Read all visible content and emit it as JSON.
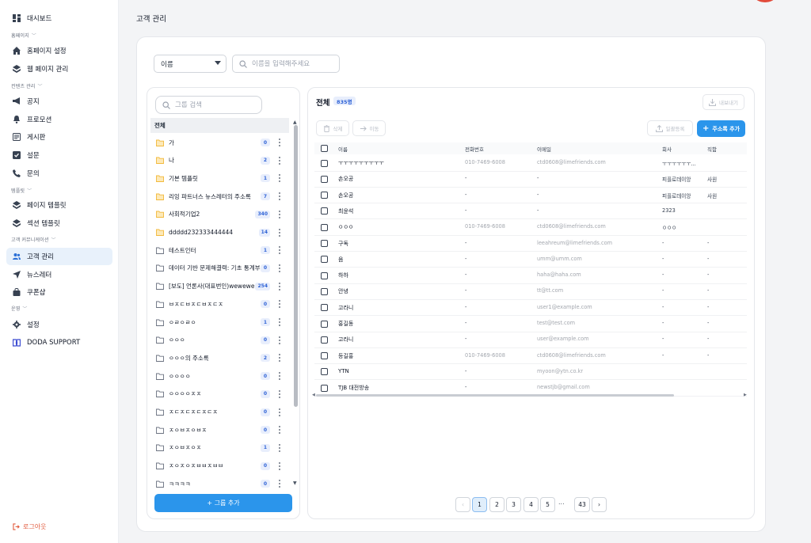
{
  "sidebar": {
    "items": [
      {
        "label": "대시보드",
        "icon": "dashboard-icon"
      },
      {
        "label": "홈페이지 설정",
        "icon": "home-icon"
      },
      {
        "label": "웹 페이지 관리",
        "icon": "layers-icon"
      },
      {
        "label": "공지",
        "icon": "megaphone-icon"
      },
      {
        "label": "프로모션",
        "icon": "bell-icon"
      },
      {
        "label": "게시판",
        "icon": "board-icon"
      },
      {
        "label": "설문",
        "icon": "checklist-icon"
      },
      {
        "label": "문의",
        "icon": "phone-icon"
      },
      {
        "label": "페이지 템플릿",
        "icon": "layers-icon"
      },
      {
        "label": "섹션 템플릿",
        "icon": "layers-icon"
      },
      {
        "label": "고객 관리",
        "icon": "users-icon"
      },
      {
        "label": "뉴스레터",
        "icon": "send-icon"
      },
      {
        "label": "쿠폰샵",
        "icon": "bag-icon"
      },
      {
        "label": "설정",
        "icon": "gear-icon"
      },
      {
        "label": "DODA SUPPORT",
        "icon": "doda-logo-icon"
      }
    ],
    "sections": [
      "홈페이지",
      "컨텐츠 관리",
      "템플릿",
      "고객 커뮤니케이션",
      "운영"
    ],
    "logout": "로그아웃",
    "active_index": 10
  },
  "page": {
    "title": "고객 관리"
  },
  "filter": {
    "selected": "이름",
    "search_placeholder": "이름을 입력해주세요"
  },
  "groups": {
    "search_placeholder": "그룹 검색",
    "all_label": "전체",
    "items": [
      {
        "name": "가",
        "count": "0"
      },
      {
        "name": "나",
        "count": "2"
      },
      {
        "name": "기본 템플릿",
        "count": "1"
      },
      {
        "name": "리잉 파트너스 뉴스레터의 주소록",
        "count": "7"
      },
      {
        "name": "사회적기업2",
        "count": "340"
      },
      {
        "name": "ddddd232333444444",
        "count": "14"
      },
      {
        "name": "테스트인터",
        "count": "1"
      },
      {
        "name": "데이터 기반 문제해결력: 기초 통계부",
        "count": "0"
      },
      {
        "name": "[보도] 언론사(대표번인)wewewe",
        "count": "254"
      },
      {
        "name": "ㅂㅈㄷㅂㅈㄷㅂㅈㄷㅈ",
        "count": "0"
      },
      {
        "name": "ㅇㄹㅇㄹㅇ",
        "count": "1"
      },
      {
        "name": "ㅇㅇㅇ",
        "count": "0"
      },
      {
        "name": "ㅇㅇㅇ의 주소록",
        "count": "2"
      },
      {
        "name": "ㅇㅇㅇㅇ",
        "count": "0"
      },
      {
        "name": "ㅇㅇㅇㅇㅈㅈ",
        "count": "0"
      },
      {
        "name": "ㅈㄷㅈㄷㅈㄷㅈㄷㅈ",
        "count": "0"
      },
      {
        "name": "ㅈㅇㅂㅈㅇㅂㅈ",
        "count": "0"
      },
      {
        "name": "ㅈㅇㅂㅈㅇㅈ",
        "count": "1"
      },
      {
        "name": "ㅈㅇㅈㅇㅈㅂㅂㅈㅂㅂ",
        "count": "0"
      },
      {
        "name": "ㅋㅋㅋㅋ",
        "count": "0"
      }
    ],
    "add_button": "+ 그룹 추가"
  },
  "contacts": {
    "title": "전체",
    "count_badge": "835명",
    "export_label": "내보내기",
    "delete_label": "삭제",
    "move_label": "이동",
    "bulk_label": "일괄등록",
    "add_label": "주소록 추가",
    "columns": [
      "이름",
      "전화번호",
      "이메일",
      "회사",
      "직함"
    ],
    "rows": [
      {
        "name": "ㅜㅜㅜㅜㅜㅜㅜㅜㅜ",
        "phone": "010-7469-6008",
        "email": "ctd0608@limefriends.com",
        "company": "ㅜㅜㅜㅜㅜㅜ...",
        "title": ""
      },
      {
        "name": "손오공",
        "phone": "-",
        "email": "-",
        "company": "피플로데이앙",
        "title": "사원"
      },
      {
        "name": "손오공",
        "phone": "-",
        "email": "-",
        "company": "피플로데이앙",
        "title": "사원"
      },
      {
        "name": "최윤석",
        "phone": "-",
        "email": "-",
        "company": "2323",
        "title": ""
      },
      {
        "name": "ㅇㅇㅇ",
        "phone": "010-7469-6008",
        "email": "ctd0608@limefriends.com",
        "company": "ㅇㅇㅇ",
        "title": ""
      },
      {
        "name": "구독",
        "phone": "-",
        "email": "leeahreum@limefriends.com",
        "company": "-",
        "title": "-"
      },
      {
        "name": "음",
        "phone": "-",
        "email": "umm@umm.com",
        "company": "-",
        "title": "-"
      },
      {
        "name": "하하",
        "phone": "-",
        "email": "haha@haha.com",
        "company": "-",
        "title": "-"
      },
      {
        "name": "안녕",
        "phone": "-",
        "email": "tt@tt.com",
        "company": "-",
        "title": "-"
      },
      {
        "name": "고라니",
        "phone": "-",
        "email": "user1@example.com",
        "company": "-",
        "title": "-"
      },
      {
        "name": "홍길동",
        "phone": "-",
        "email": "test@test.com",
        "company": "-",
        "title": "-"
      },
      {
        "name": "고라니",
        "phone": "-",
        "email": "user@example.com",
        "company": "-",
        "title": "-"
      },
      {
        "name": "등길홍",
        "phone": "010-7469-6008",
        "email": "ctd0608@limefriends.com",
        "company": "-",
        "title": "-"
      },
      {
        "name": "YTN",
        "phone": "-",
        "email": "myoon@ytn.co.kr",
        "company": "",
        "title": ""
      },
      {
        "name": "TJB 대전방송",
        "phone": "-",
        "email": "newstjb@gmail.com",
        "company": "",
        "title": ""
      }
    ]
  },
  "pagination": {
    "pages": [
      "1",
      "2",
      "3",
      "4",
      "5"
    ],
    "ellipsis": "...",
    "last": "43",
    "prev": "‹",
    "next": "›",
    "current": "1"
  },
  "colors": {
    "accent": "#2b95eb",
    "badge_bg": "#e8eefc",
    "badge_text": "#2f63d6",
    "logout": "#e25a3c",
    "active_nav": "#e8f1fb"
  }
}
